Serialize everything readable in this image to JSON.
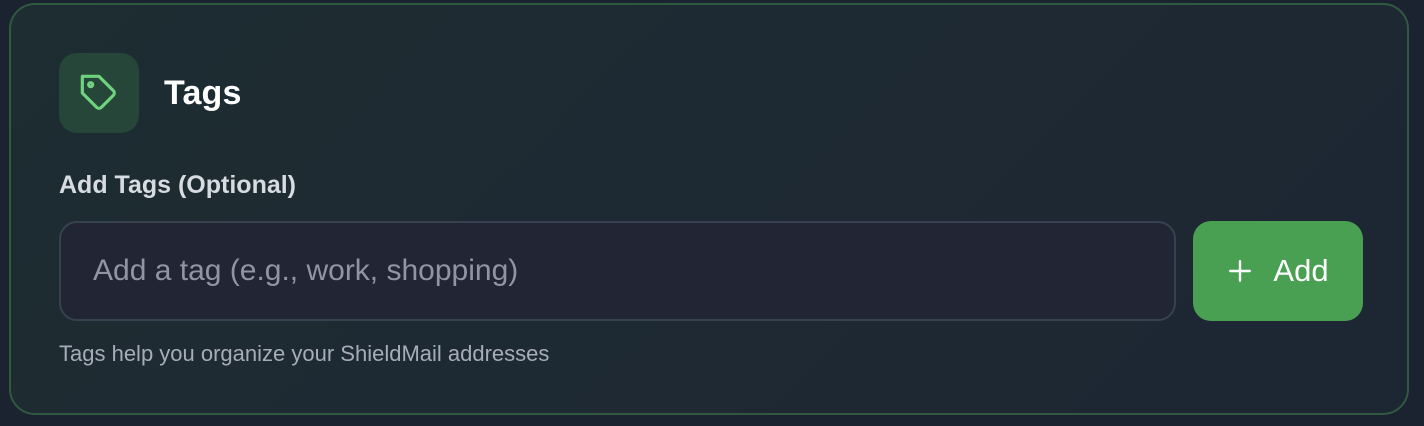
{
  "card": {
    "title": "Tags",
    "icon": "tag-icon",
    "accent_color": "#4aa052"
  },
  "form": {
    "label": "Add Tags (Optional)",
    "input_placeholder": "Add a tag (e.g., work, shopping)",
    "input_value": "",
    "add_button_label": "Add",
    "add_button_icon": "plus-icon",
    "help_text": "Tags help you organize your ShieldMail addresses"
  }
}
